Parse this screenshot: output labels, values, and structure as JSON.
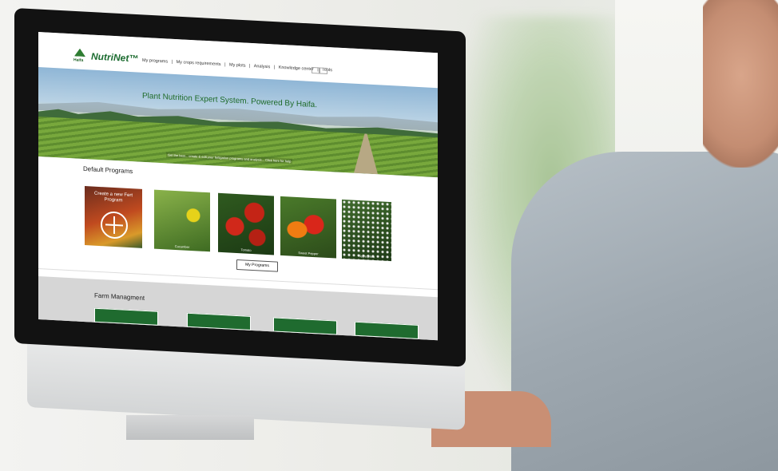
{
  "brand": {
    "logo_text": "Haifa",
    "name": "NutriNet™"
  },
  "nav": {
    "items": [
      "My programs",
      "|",
      "My crops requirements",
      "|",
      "My plots",
      "|",
      "Analysis",
      "|",
      "Knowledge center",
      "|",
      "Tools"
    ]
  },
  "hero": {
    "title": "Plant Nutrition Expert System. Powered By Haifa.",
    "subtitle": "Get the best... create & edit your fertigation programs and analysis... Click here for help"
  },
  "default_programs": {
    "title": "Default Programs",
    "create_card": "Create a new Fert Program",
    "cards": [
      "Cucumber",
      "Tomato",
      "Sweet Pepper",
      "Gypsophila"
    ],
    "my_programs_button": "My Programs"
  },
  "farm_management": {
    "title": "Farm Managment"
  }
}
